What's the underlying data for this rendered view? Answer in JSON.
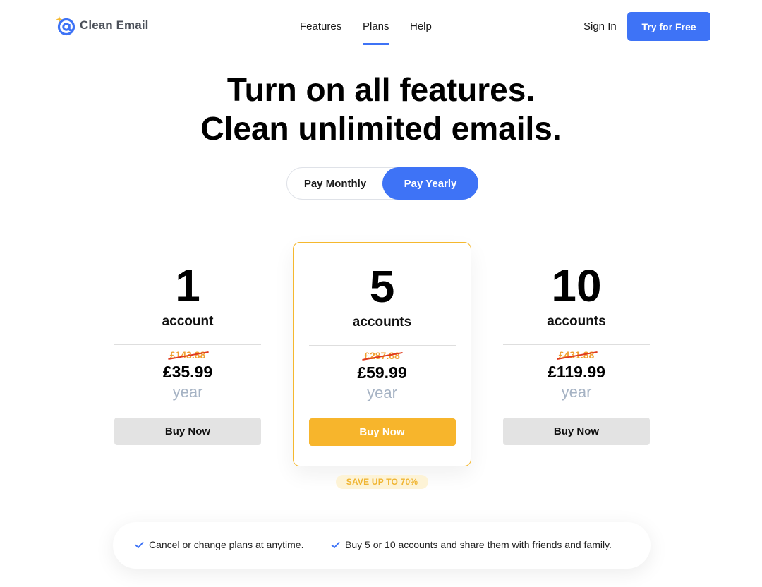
{
  "header": {
    "logo_text": "Clean Email",
    "nav": [
      {
        "label": "Features"
      },
      {
        "label": "Plans",
        "active": true
      },
      {
        "label": "Help"
      }
    ],
    "sign_in": "Sign In",
    "cta": "Try for Free"
  },
  "hero": {
    "line1": "Turn on all features.",
    "line2": "Clean unlimited emails."
  },
  "billing_toggle": {
    "monthly": "Pay Monthly",
    "yearly": "Pay Yearly",
    "selected": "yearly"
  },
  "plans": [
    {
      "count": "1",
      "unit": "account",
      "old_price": "£143.88",
      "price": "£35.99",
      "period": "year",
      "button": "Buy Now"
    },
    {
      "count": "5",
      "unit": "accounts",
      "old_price": "£287.88",
      "price": "£59.99",
      "period": "year",
      "button": "Buy Now",
      "featured": true
    },
    {
      "count": "10",
      "unit": "accounts",
      "old_price": "£431.88",
      "price": "£119.99",
      "period": "year",
      "button": "Buy Now"
    }
  ],
  "save_badge": "SAVE UP TO 70%",
  "benefits": [
    {
      "icon": "check-icon",
      "text": "Cancel or change plans at anytime."
    },
    {
      "icon": "check-icon",
      "text": "Buy 5 or 10 accounts and share them with friends and family."
    }
  ],
  "colors": {
    "accent": "#3e73f6",
    "featured": "#f7b52c",
    "old_price": "#f0a030",
    "strike": "#e03a1e",
    "period": "#a6b3c4"
  }
}
